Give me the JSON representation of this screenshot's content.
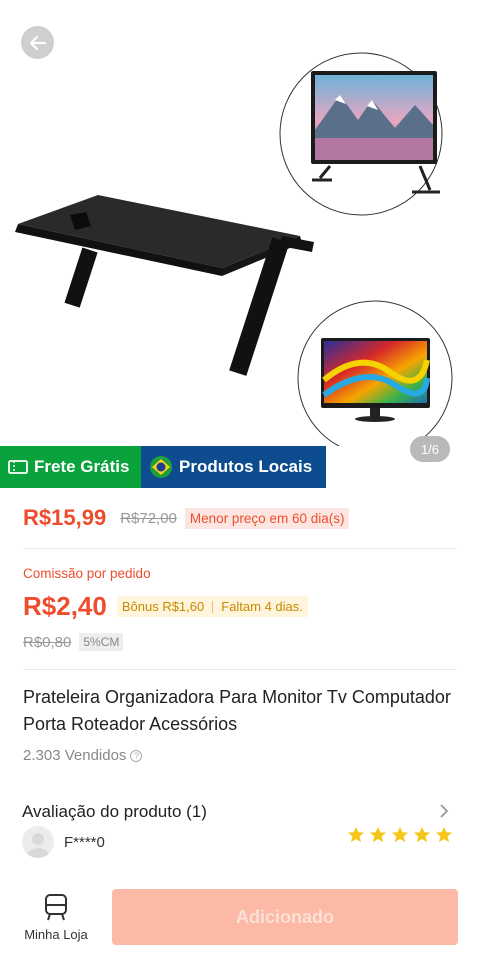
{
  "gallery": {
    "counter": "1/6"
  },
  "badges": {
    "free_shipping": "Frete Grátis",
    "local_products": "Produtos Locais"
  },
  "price": {
    "current": "R$15,99",
    "original": "R$72,00",
    "lowest_tag": "Menor preço em 60 dia(s)"
  },
  "commission": {
    "label": "Comissão por pedido",
    "amount": "R$2,40",
    "bonus": "Bônus R$1,60",
    "remaining": "Faltam 4 dias.",
    "old_amount": "R$0,80",
    "rate_tag": "5%CM"
  },
  "product": {
    "title": "Prateleira Organizadora Para Monitor Tv Computador Porta Roteador Acessórios",
    "sold": "2.303 Vendidos"
  },
  "review": {
    "title": "Avaliação do produto (1)",
    "reviewer": "F****0",
    "rating": 5
  },
  "bottom": {
    "store_label": "Minha Loja",
    "add_button": "Adicionado"
  },
  "colors": {
    "accent": "#ee4d2d",
    "green_badge": "#0aa23c",
    "blue_badge": "#0c4c8f",
    "star": "#f5c518",
    "button_disabled": "#fbb9a6"
  }
}
